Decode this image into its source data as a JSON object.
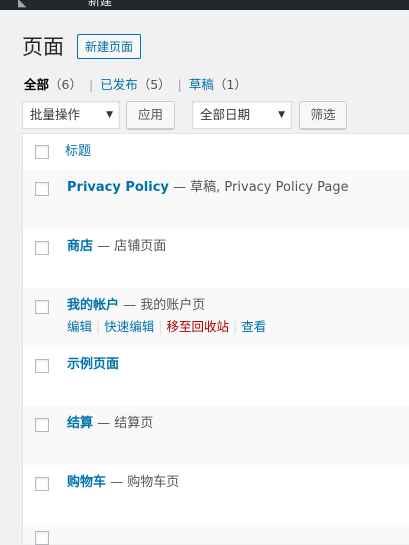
{
  "admin_bar": {
    "text": "新建"
  },
  "page": {
    "title": "页面",
    "add_new_label": "新建页面"
  },
  "views": [
    {
      "label": "全部",
      "count": "（6）",
      "current": true
    },
    {
      "label": "已发布",
      "count": "（5）",
      "current": false
    },
    {
      "label": "草稿",
      "count": "（1）",
      "current": false
    }
  ],
  "views_separator": "|",
  "filters": {
    "bulk_action": "批量操作",
    "apply_label": "应用",
    "date_filter": "全部日期",
    "filter_label": "筛选"
  },
  "table": {
    "column_title": "标题",
    "rows": [
      {
        "title": "Privacy Policy",
        "state": " — 草稿, Privacy Policy Page",
        "actions": []
      },
      {
        "title": "商店",
        "state": " — 店铺页面",
        "actions": []
      },
      {
        "title": "我的帐户",
        "state": " — 我的账户页",
        "actions": [
          "编辑",
          "快速编辑",
          "移至回收站",
          "查看"
        ]
      },
      {
        "title": "示例页面",
        "state": "",
        "actions": []
      },
      {
        "title": "结算",
        "state": " — 结算页",
        "actions": []
      },
      {
        "title": "购物车",
        "state": " — 购物车页",
        "actions": []
      }
    ]
  },
  "colors": {
    "link": "#0073aa",
    "trash": "#aa0000",
    "background": "#f1f1f1"
  }
}
